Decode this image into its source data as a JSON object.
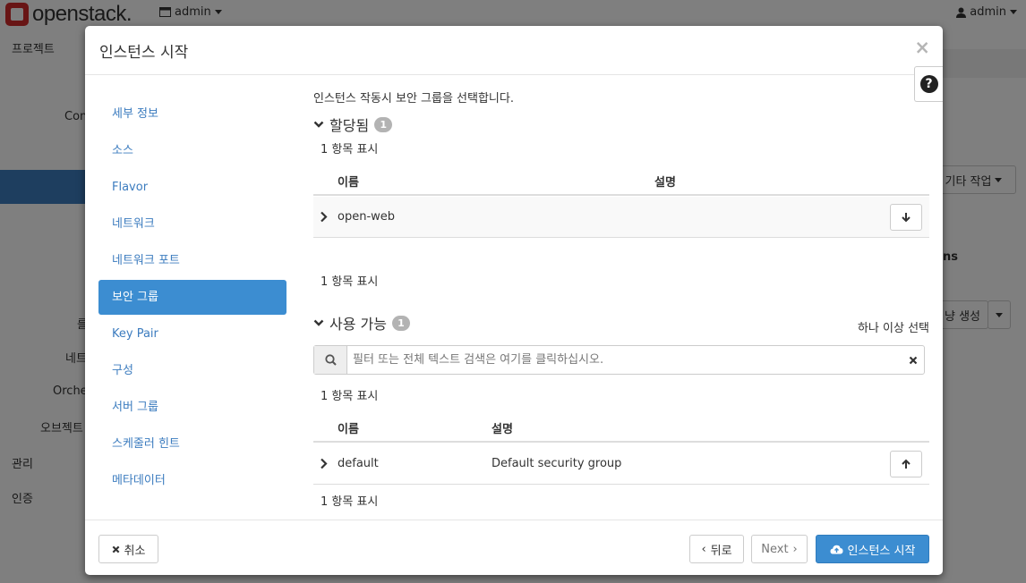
{
  "background": {
    "brand": "openstack.",
    "project_menu": "admin",
    "user_menu": "admin",
    "sidebar_items": [
      "프로젝트",
      "Con",
      "를",
      "네트",
      "Orche",
      "오브젝트",
      "관리",
      "인증"
    ],
    "right_fragments": {
      "more_actions": "기타 작업",
      "ns": "ns",
      "snapshot": "냥 생성"
    }
  },
  "modal": {
    "title": "인스턴스 시작",
    "close_glyph": "×",
    "help_glyph": "?",
    "nav_items": [
      {
        "label": "세부 정보"
      },
      {
        "label": "소스"
      },
      {
        "label": "Flavor"
      },
      {
        "label": "네트워크"
      },
      {
        "label": "네트워크 포트"
      },
      {
        "label": "보안 그룹",
        "active": true
      },
      {
        "label": "Key Pair"
      },
      {
        "label": "구성"
      },
      {
        "label": "서버 그룹"
      },
      {
        "label": "스케줄러 힌트"
      },
      {
        "label": "메타데이터"
      }
    ],
    "step": {
      "help_text": "인스턴스 작동시 보안 그룹을 선택합니다.",
      "allocated": {
        "title": "할당됨",
        "count": "1",
        "items_count_top": "1 항목 표시",
        "columns": {
          "name": "이름",
          "description": "설명"
        },
        "rows": [
          {
            "name": "open-web",
            "description": ""
          }
        ],
        "items_count_bottom": "1 항목 표시"
      },
      "available": {
        "title": "사용 가능",
        "count": "1",
        "select_hint": "하나 이상 선택",
        "search_placeholder": "필터 또는 전체 텍스트 검색은 여기를 클릭하십시오.",
        "items_count_top": "1 항목 표시",
        "columns": {
          "name": "이름",
          "description": "설명"
        },
        "rows": [
          {
            "name": "default",
            "description": "Default security group"
          }
        ],
        "items_count_bottom": "1 항목 표시"
      }
    },
    "footer": {
      "cancel": "취소",
      "back": "뒤로",
      "next": "Next",
      "launch": "인스턴스 시작"
    }
  },
  "colors": {
    "accent": "#3c8dd1",
    "link": "#3c7cbf",
    "brand_red": "#d12a2a",
    "badge": "#b3b3b3"
  }
}
